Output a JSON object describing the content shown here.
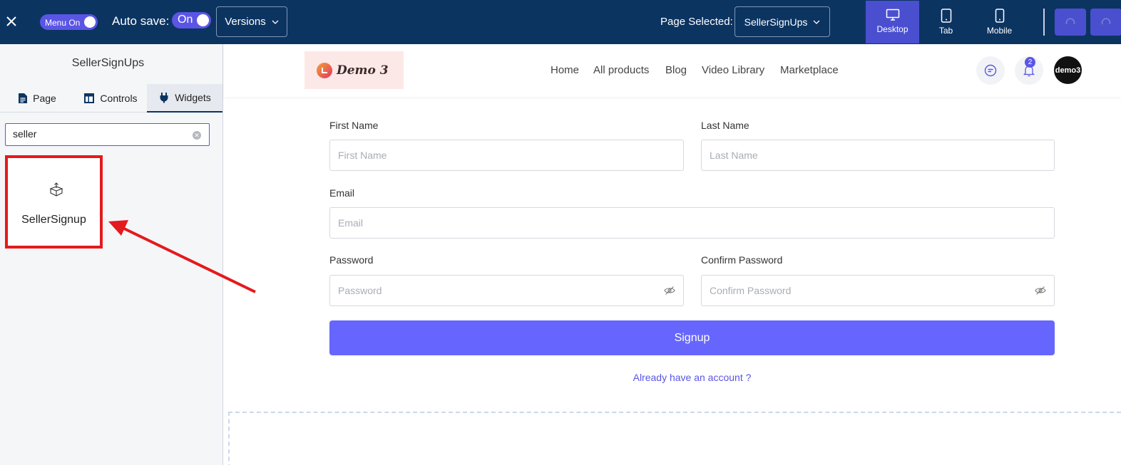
{
  "topbar": {
    "menu_toggle_label": "Menu On",
    "autosave_label": "Auto save:",
    "autosave_toggle_label": "On",
    "versions_label": "Versions",
    "page_selected_label": "Page Selected:",
    "page_selected_value": "SellerSignUps",
    "devices": [
      {
        "label": "Desktop",
        "active": true
      },
      {
        "label": "Tab",
        "active": false
      },
      {
        "label": "Mobile",
        "active": false
      }
    ]
  },
  "sidebar": {
    "title": "SellerSignUps",
    "tabs": [
      {
        "label": "Page",
        "icon": "document-icon"
      },
      {
        "label": "Controls",
        "icon": "layout-icon"
      },
      {
        "label": "Widgets",
        "icon": "plug-icon",
        "active": true
      }
    ],
    "search_value": "seller",
    "widget_label": "SellerSignup"
  },
  "site": {
    "logo_text": "Demo 3",
    "nav": [
      "Home",
      "All products",
      "Blog",
      "Video Library",
      "Marketplace"
    ],
    "notification_count": "2",
    "avatar_text": "demo3"
  },
  "form": {
    "first_name_label": "First Name",
    "first_name_placeholder": "First Name",
    "last_name_label": "Last Name",
    "last_name_placeholder": "Last Name",
    "email_label": "Email",
    "email_placeholder": "Email",
    "password_label": "Password",
    "password_placeholder": "Password",
    "confirm_password_label": "Confirm Password",
    "confirm_password_placeholder": "Confirm Password",
    "signup_label": "Signup",
    "already_account_label": "Already have an account ?"
  },
  "colors": {
    "topbar_bg": "#0c3461",
    "accent": "#5b55e6",
    "signup_button": "#6666ff",
    "highlight_red": "#e41a1c"
  }
}
